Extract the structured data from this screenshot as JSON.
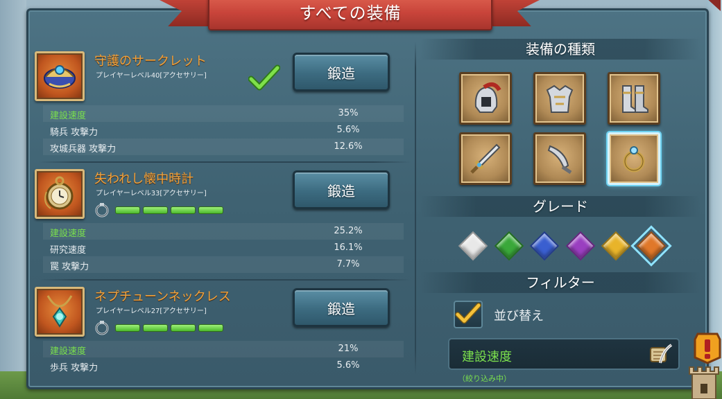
{
  "header": {
    "title": "すべての装備"
  },
  "equipment": [
    {
      "name": "守護のサークレット",
      "requirement": "プレイヤーレベル40[アクセサリー]",
      "button": "鍛造",
      "checked": true,
      "icon": "circlet-icon",
      "stats": [
        {
          "label": "建設速度",
          "value": "35%",
          "highlight": true
        },
        {
          "label": "騎兵 攻撃力",
          "value": "5.6%",
          "highlight": false
        },
        {
          "label": "攻城兵器 攻撃力",
          "value": "12.6%",
          "highlight": false
        }
      ]
    },
    {
      "name": "失われし懐中時計",
      "requirement": "プレイヤーレベル33[アクセサリー]",
      "button": "鍛造",
      "checked": false,
      "icon": "pocket-watch-icon",
      "gem_slots": 4,
      "stats": [
        {
          "label": "建設速度",
          "value": "25.2%",
          "highlight": true
        },
        {
          "label": "研究速度",
          "value": "16.1%",
          "highlight": false
        },
        {
          "label": "罠 攻撃力",
          "value": "7.7%",
          "highlight": false
        }
      ]
    },
    {
      "name": "ネプチューンネックレス",
      "requirement": "プレイヤーレベル27[アクセサリー]",
      "button": "鍛造",
      "checked": false,
      "icon": "necklace-icon",
      "gem_slots": 4,
      "stats": [
        {
          "label": "建設速度",
          "value": "21%",
          "highlight": true
        },
        {
          "label": "歩兵 攻撃力",
          "value": "5.6%",
          "highlight": false
        }
      ]
    }
  ],
  "equipment_types": {
    "title": "装備の種類",
    "items": [
      {
        "icon": "helmet-icon",
        "selected": false
      },
      {
        "icon": "armor-icon",
        "selected": false
      },
      {
        "icon": "boots-icon",
        "selected": false
      },
      {
        "icon": "sword-icon",
        "selected": false
      },
      {
        "icon": "offhand-blade-icon",
        "selected": false
      },
      {
        "icon": "ring-icon",
        "selected": true
      }
    ]
  },
  "grade": {
    "title": "グレード",
    "gems": [
      {
        "color": "#e8e8e8",
        "selected": false
      },
      {
        "color": "#3aa83a",
        "selected": false
      },
      {
        "color": "#3a5fd0",
        "selected": false
      },
      {
        "color": "#9a3fc0",
        "selected": false
      },
      {
        "color": "#e8b42a",
        "selected": false
      },
      {
        "color": "#e0782a",
        "selected": true
      }
    ]
  },
  "filter": {
    "title": "フィルター",
    "sort_label": "並び替え",
    "sort_checked": true,
    "selected_value": "建設速度",
    "note": "（絞り込み中）"
  },
  "colors": {
    "accent_orange": "#f2a23c",
    "stat_green": "#7be04d",
    "panel": "#3f6272",
    "ribbon": "#c8443a"
  }
}
